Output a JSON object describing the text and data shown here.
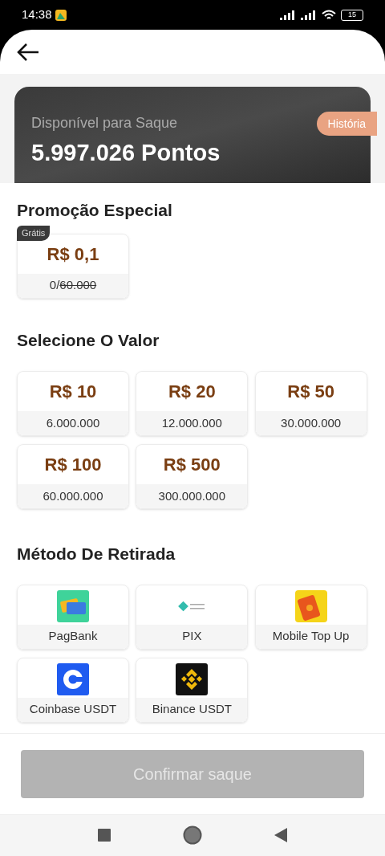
{
  "status_bar": {
    "time": "14:38",
    "battery": "15"
  },
  "balance": {
    "label": "Disponível para Saque",
    "amount": "5.997.026 Pontos",
    "history_button": "História"
  },
  "promotion": {
    "title": "Promoção Especial",
    "offer": {
      "badge": "Grátis",
      "value": "R$ 0,1",
      "claimed": "0/",
      "limit": "60.000"
    }
  },
  "amounts": {
    "title": "Selecione O Valor",
    "options": [
      {
        "value": "R$ 10",
        "points": "6.000.000",
        "selected": false
      },
      {
        "value": "R$ 20",
        "points": "12.000.000",
        "selected": false
      },
      {
        "value": "R$ 50",
        "points": "30.000.000",
        "selected": false
      },
      {
        "value": "R$ 100",
        "points": "60.000.000",
        "selected": false
      },
      {
        "value": "R$ 500",
        "points": "300.000.000",
        "selected": false
      }
    ]
  },
  "methods": {
    "title": "Método De Retirada",
    "options": [
      {
        "kind": "cards",
        "label": "PagBank",
        "selected": false
      },
      {
        "kind": "diamond",
        "label": "PIX",
        "selected": false
      },
      {
        "kind": "phone",
        "label": "Mobile Top Up",
        "selected": false
      },
      {
        "kind": "c",
        "label": "Coinbase USDT",
        "selected": false
      },
      {
        "kind": "rhombus",
        "label": "Binance USDT",
        "selected": false
      }
    ]
  },
  "confirm_button": {
    "label": "Confirmar saque",
    "disabled": true
  }
}
